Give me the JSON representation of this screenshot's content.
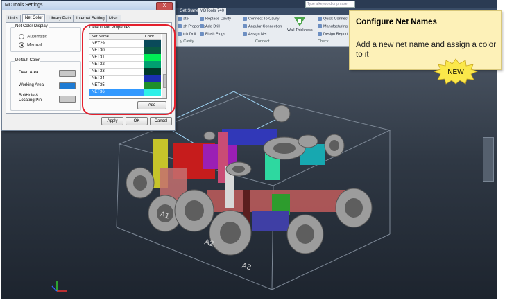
{
  "app": {
    "tabs": [
      "Get Started",
      "MDTools 740"
    ],
    "search_placeholder": "Type a keyword or phrase",
    "ribbon": {
      "items": [
        "ate",
        "Replace Cavity",
        "Connect To Cavity",
        "Quick Connect",
        "sh Properties",
        "Add Drill",
        "Angular Connection",
        "Manufacturing",
        "tch Drill",
        "Flush Plugs",
        "Assign Net",
        "Design Report",
        "Wall Thickness"
      ],
      "groups": [
        "y Cavity",
        "Connect",
        "Check"
      ]
    },
    "port_labels": [
      "A1",
      "A2",
      "A3"
    ]
  },
  "dialog": {
    "title": "MDTools Settings",
    "close_label": "X",
    "tabs": [
      "Units",
      "Net Color",
      "Library Path",
      "Internet Setting",
      "Misc."
    ],
    "active_tab": "Net Color",
    "net_color_display": {
      "label": "Net Color Display",
      "options": [
        "Automatic",
        "Manual"
      ],
      "selected": "Manual"
    },
    "default_color": {
      "label": "Default Color",
      "items": [
        {
          "label": "Dead Area",
          "color": "#c8c8c8"
        },
        {
          "label": "Working Area",
          "color": "#1e7bd3"
        },
        {
          "label": "BoltHole & Locating Pin",
          "color": "#c8c8c8"
        }
      ]
    },
    "default_net_properties": {
      "label": "Default Net Properties",
      "columns": [
        "Net Name",
        "Color"
      ],
      "rows": [
        {
          "name": "NET29",
          "color": "#0a4a5a"
        },
        {
          "name": "NET30",
          "color": "#0a5a42"
        },
        {
          "name": "NET31",
          "color": "#00ee55"
        },
        {
          "name": "NET32",
          "color": "#00a070"
        },
        {
          "name": "NET33",
          "color": "#003a2a"
        },
        {
          "name": "NET34",
          "color": "#1a2fb0"
        },
        {
          "name": "NET35",
          "color": "#1f8f2a"
        },
        {
          "name": "NET36",
          "color": "#2ef0e8"
        }
      ],
      "selected": "NET36",
      "add_label": "Add"
    },
    "buttons": {
      "apply": "Apply",
      "ok": "OK",
      "cancel": "Cancel"
    }
  },
  "callout": {
    "title": "Configure Net Names",
    "body": "Add a new net name and assign a color to it",
    "badge": "NEW"
  }
}
